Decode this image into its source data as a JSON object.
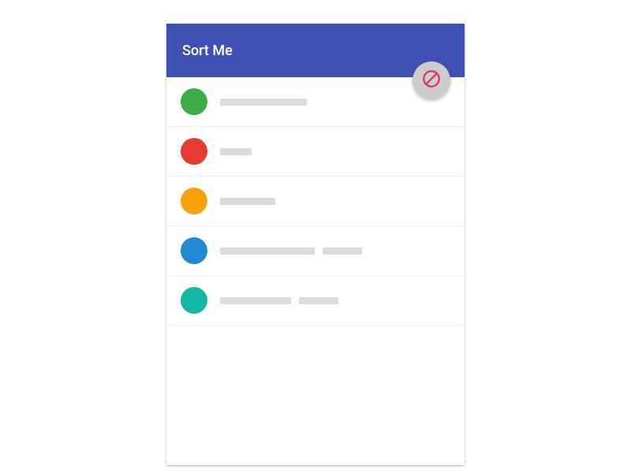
{
  "header": {
    "title": "Sort Me"
  },
  "fab": {
    "icon": "filter-disabled-icon",
    "iconColor": "#e6256b",
    "bgColor": "#cccccc"
  },
  "list": {
    "items": [
      {
        "color": "#3cad46",
        "bars": [
          110
        ]
      },
      {
        "color": "#e53a30",
        "bars": [
          40
        ]
      },
      {
        "color": "#f5a20b",
        "bars": [
          70
        ]
      },
      {
        "color": "#1e88d2",
        "bars": [
          120,
          50
        ]
      },
      {
        "color": "#12b8a3",
        "bars": [
          90,
          50
        ]
      }
    ]
  }
}
